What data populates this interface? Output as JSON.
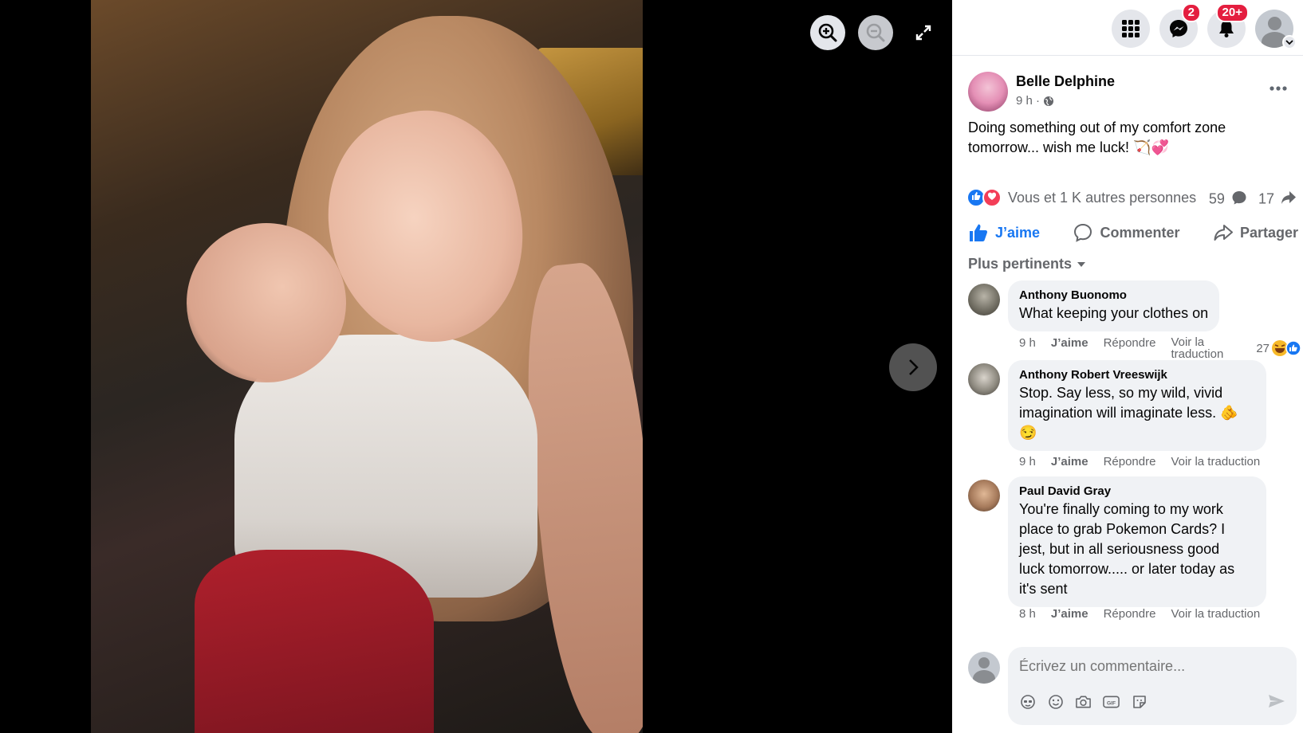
{
  "viewer": {
    "controls": [
      "zoom-in",
      "zoom-out",
      "fullscreen",
      "next"
    ]
  },
  "topbar": {
    "messenger_badge": "2",
    "notifications_badge": "20+"
  },
  "post": {
    "author": "Belle Delphine",
    "time": "9 h ·",
    "text_line1": "Doing something out of my comfort zone",
    "text_line2": "tomorrow... wish me luck! 🏹💞",
    "reactions_text": "Vous et 1 K autres personnes",
    "comments_count": "59",
    "shares_count": "17"
  },
  "actions": {
    "like": "J’aime",
    "comment": "Commenter",
    "share": "Partager"
  },
  "sort_label": "Plus pertinents",
  "comments": [
    {
      "name": "Anthony Buonomo",
      "text": "What keeping your clothes on",
      "time": "9 h",
      "like": "J’aime",
      "reply": "Répondre",
      "translate": "Voir la traduction",
      "reactions": "27"
    },
    {
      "name": "Anthony Robert Vreeswijk",
      "text_line1": "Stop. Say less, so my wild, vivid",
      "text_line2": "imagination will imaginate less. 🫵",
      "text_line3": "😏",
      "time": "9 h",
      "like": "J’aime",
      "reply": "Répondre",
      "translate": "Voir la traduction"
    },
    {
      "name": "Paul David Gray",
      "text_line1": "You're finally coming to my work",
      "text_line2": "place to grab Pokemon Cards? I",
      "text_line3": "jest, but in all seriousness good",
      "text_line4": "luck tomorrow..... or later today as",
      "text_line5": "it's sent",
      "time": "8 h",
      "like": "J’aime",
      "reply": "Répondre",
      "translate": "Voir la traduction"
    }
  ],
  "composer": {
    "placeholder": "Écrivez un commentaire..."
  },
  "colors": {
    "accent": "#1877f2",
    "badge": "#e41e3f",
    "bubble": "#f0f2f5",
    "muted": "#65676b"
  }
}
